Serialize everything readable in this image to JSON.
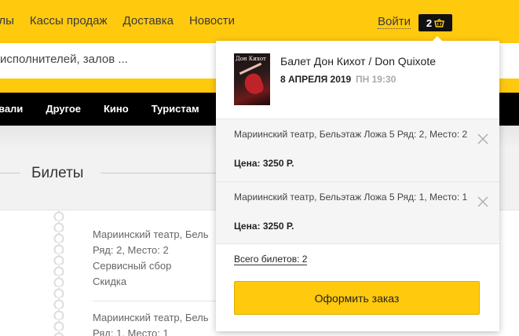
{
  "topnav": {
    "items": [
      "алы",
      "Кассы продаж",
      "Доставка",
      "Новости"
    ],
    "login": "Войти",
    "cart_count": "2"
  },
  "search": {
    "placeholder": "исполнителей, залов ..."
  },
  "categories": [
    "вали",
    "Другое",
    "Кино",
    "Туристам"
  ],
  "tickets_section": {
    "title": "Билеты",
    "items": [
      {
        "lines": [
          "Мариинский театр, Бель",
          "Ряд: 2, Место: 2",
          "Сервисный сбор",
          "Скидка"
        ]
      },
      {
        "lines": [
          "Мариинский театр, Бель",
          "Ряд: 1, Место: 1"
        ]
      }
    ]
  },
  "cart_dropdown": {
    "event": {
      "poster_text": "Дон Кихот",
      "title": "Балет Дон Кихот / Don Quixote",
      "date": "8 АПРЕЛЯ 2019",
      "time": "ПН 19:30"
    },
    "tickets": [
      {
        "place": "Мариинский театр, Бельэтаж Ложа 5 Ряд: 2, Место: 2",
        "price": "Цена: 3250 Р."
      },
      {
        "place": "Мариинский театр, Бельэтаж Ложа 5 Ряд: 1, Место: 1",
        "price": "Цена: 3250 Р."
      }
    ],
    "total_label": "Всего билетов: 2",
    "order_button": "Оформить заказ"
  },
  "colors": {
    "accent": "#ffc90e",
    "navbar": "#000000"
  }
}
